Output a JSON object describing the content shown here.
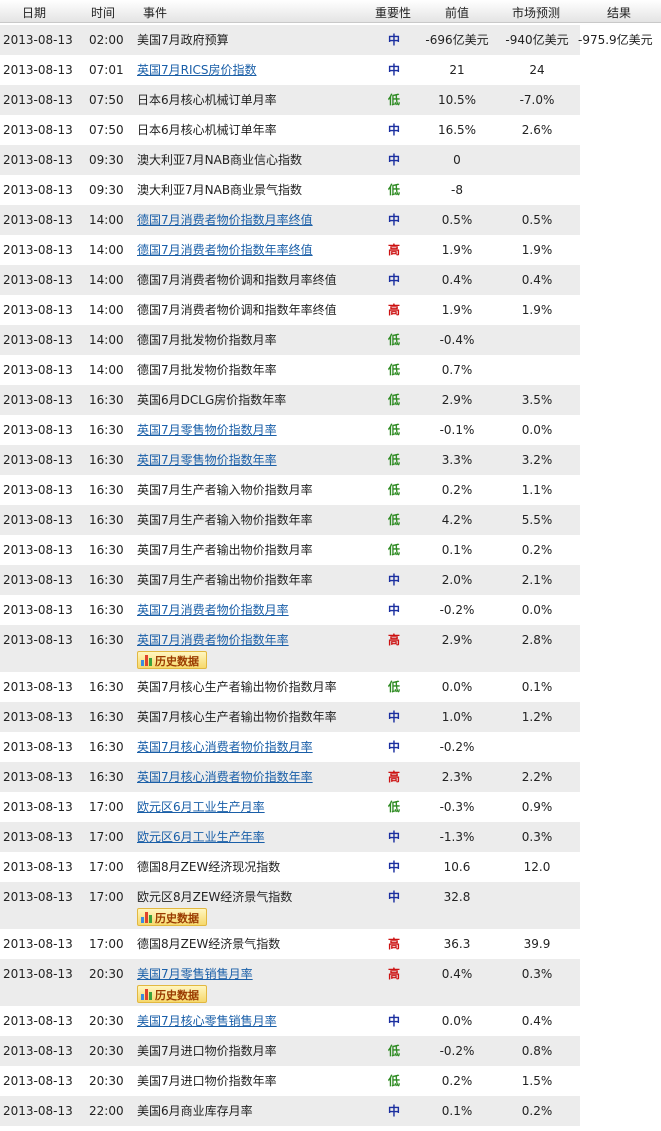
{
  "headers": {
    "date": "日期",
    "time": "时间",
    "event": "事件",
    "importance": "重要性",
    "previous": "前值",
    "forecast": "市场预测",
    "result": "结果"
  },
  "history_label": "历史数据",
  "colors": {
    "importance_medium": "#1b2fa0",
    "importance_low": "#2e8b22",
    "importance_high": "#cc1111",
    "link": "#1a5fa8",
    "stripe": "#ececec"
  },
  "rows": [
    {
      "date": "2013-08-13",
      "time": "02:00",
      "event": "美国7月政府预算",
      "link": false,
      "importance": "中",
      "previous": "-696亿美元",
      "forecast": "-940亿美元",
      "result": "-975.9亿美元"
    },
    {
      "date": "2013-08-13",
      "time": "07:01",
      "event": "英国7月RICS房价指数",
      "link": true,
      "importance": "中",
      "previous": "21",
      "forecast": "24",
      "result": ""
    },
    {
      "date": "2013-08-13",
      "time": "07:50",
      "event": "日本6月核心机械订单月率",
      "link": false,
      "importance": "低",
      "previous": "10.5%",
      "forecast": "-7.0%",
      "result": ""
    },
    {
      "date": "2013-08-13",
      "time": "07:50",
      "event": "日本6月核心机械订单年率",
      "link": false,
      "importance": "中",
      "previous": "16.5%",
      "forecast": "2.6%",
      "result": ""
    },
    {
      "date": "2013-08-13",
      "time": "09:30",
      "event": "澳大利亚7月NAB商业信心指数",
      "link": false,
      "importance": "中",
      "previous": "0",
      "forecast": "",
      "result": ""
    },
    {
      "date": "2013-08-13",
      "time": "09:30",
      "event": "澳大利亚7月NAB商业景气指数",
      "link": false,
      "importance": "低",
      "previous": "-8",
      "forecast": "",
      "result": ""
    },
    {
      "date": "2013-08-13",
      "time": "14:00",
      "event": "德国7月消费者物价指数月率终值",
      "link": true,
      "importance": "中",
      "previous": "0.5%",
      "forecast": "0.5%",
      "result": ""
    },
    {
      "date": "2013-08-13",
      "time": "14:00",
      "event": "德国7月消费者物价指数年率终值",
      "link": true,
      "importance": "高",
      "previous": "1.9%",
      "forecast": "1.9%",
      "result": ""
    },
    {
      "date": "2013-08-13",
      "time": "14:00",
      "event": "德国7月消费者物价调和指数月率终值",
      "link": false,
      "importance": "中",
      "previous": "0.4%",
      "forecast": "0.4%",
      "result": ""
    },
    {
      "date": "2013-08-13",
      "time": "14:00",
      "event": "德国7月消费者物价调和指数年率终值",
      "link": false,
      "importance": "高",
      "previous": "1.9%",
      "forecast": "1.9%",
      "result": ""
    },
    {
      "date": "2013-08-13",
      "time": "14:00",
      "event": "德国7月批发物价指数月率",
      "link": false,
      "importance": "低",
      "previous": "-0.4%",
      "forecast": "",
      "result": ""
    },
    {
      "date": "2013-08-13",
      "time": "14:00",
      "event": "德国7月批发物价指数年率",
      "link": false,
      "importance": "低",
      "previous": "0.7%",
      "forecast": "",
      "result": ""
    },
    {
      "date": "2013-08-13",
      "time": "16:30",
      "event": "英国6月DCLG房价指数年率",
      "link": false,
      "importance": "低",
      "previous": "2.9%",
      "forecast": "3.5%",
      "result": ""
    },
    {
      "date": "2013-08-13",
      "time": "16:30",
      "event": "英国7月零售物价指数月率",
      "link": true,
      "importance": "低",
      "previous": "-0.1%",
      "forecast": "0.0%",
      "result": ""
    },
    {
      "date": "2013-08-13",
      "time": "16:30",
      "event": "英国7月零售物价指数年率",
      "link": true,
      "importance": "低",
      "previous": "3.3%",
      "forecast": "3.2%",
      "result": ""
    },
    {
      "date": "2013-08-13",
      "time": "16:30",
      "event": "英国7月生产者输入物价指数月率",
      "link": false,
      "importance": "低",
      "previous": "0.2%",
      "forecast": "1.1%",
      "result": ""
    },
    {
      "date": "2013-08-13",
      "time": "16:30",
      "event": "英国7月生产者输入物价指数年率",
      "link": false,
      "importance": "低",
      "previous": "4.2%",
      "forecast": "5.5%",
      "result": ""
    },
    {
      "date": "2013-08-13",
      "time": "16:30",
      "event": "英国7月生产者输出物价指数月率",
      "link": false,
      "importance": "低",
      "previous": "0.1%",
      "forecast": "0.2%",
      "result": ""
    },
    {
      "date": "2013-08-13",
      "time": "16:30",
      "event": "英国7月生产者输出物价指数年率",
      "link": false,
      "importance": "中",
      "previous": "2.0%",
      "forecast": "2.1%",
      "result": ""
    },
    {
      "date": "2013-08-13",
      "time": "16:30",
      "event": "英国7月消费者物价指数月率",
      "link": true,
      "importance": "中",
      "previous": "-0.2%",
      "forecast": "0.0%",
      "result": ""
    },
    {
      "date": "2013-08-13",
      "time": "16:30",
      "event": "英国7月消费者物价指数年率",
      "link": true,
      "importance": "高",
      "previous": "2.9%",
      "forecast": "2.8%",
      "result": "",
      "history": true
    },
    {
      "date": "2013-08-13",
      "time": "16:30",
      "event": "英国7月核心生产者输出物价指数月率",
      "link": false,
      "importance": "低",
      "previous": "0.0%",
      "forecast": "0.1%",
      "result": ""
    },
    {
      "date": "2013-08-13",
      "time": "16:30",
      "event": "英国7月核心生产者输出物价指数年率",
      "link": false,
      "importance": "中",
      "previous": "1.0%",
      "forecast": "1.2%",
      "result": ""
    },
    {
      "date": "2013-08-13",
      "time": "16:30",
      "event": "英国7月核心消费者物价指数月率",
      "link": true,
      "importance": "中",
      "previous": "-0.2%",
      "forecast": "",
      "result": ""
    },
    {
      "date": "2013-08-13",
      "time": "16:30",
      "event": "英国7月核心消费者物价指数年率",
      "link": true,
      "importance": "高",
      "previous": "2.3%",
      "forecast": "2.2%",
      "result": ""
    },
    {
      "date": "2013-08-13",
      "time": "17:00",
      "event": "欧元区6月工业生产月率",
      "link": true,
      "importance": "低",
      "previous": "-0.3%",
      "forecast": "0.9%",
      "result": ""
    },
    {
      "date": "2013-08-13",
      "time": "17:00",
      "event": "欧元区6月工业生产年率",
      "link": true,
      "importance": "中",
      "previous": "-1.3%",
      "forecast": "0.3%",
      "result": ""
    },
    {
      "date": "2013-08-13",
      "time": "17:00",
      "event": "德国8月ZEW经济现况指数",
      "link": false,
      "importance": "中",
      "previous": "10.6",
      "forecast": "12.0",
      "result": ""
    },
    {
      "date": "2013-08-13",
      "time": "17:00",
      "event": "欧元区8月ZEW经济景气指数",
      "link": false,
      "importance": "中",
      "previous": "32.8",
      "forecast": "",
      "result": "",
      "history": true
    },
    {
      "date": "2013-08-13",
      "time": "17:00",
      "event": "德国8月ZEW经济景气指数",
      "link": false,
      "importance": "高",
      "previous": "36.3",
      "forecast": "39.9",
      "result": ""
    },
    {
      "date": "2013-08-13",
      "time": "20:30",
      "event": "美国7月零售销售月率",
      "link": true,
      "importance": "高",
      "previous": "0.4%",
      "forecast": "0.3%",
      "result": "",
      "history": true
    },
    {
      "date": "2013-08-13",
      "time": "20:30",
      "event": "美国7月核心零售销售月率",
      "link": true,
      "importance": "中",
      "previous": "0.0%",
      "forecast": "0.4%",
      "result": ""
    },
    {
      "date": "2013-08-13",
      "time": "20:30",
      "event": "美国7月进口物价指数月率",
      "link": false,
      "importance": "低",
      "previous": "-0.2%",
      "forecast": "0.8%",
      "result": ""
    },
    {
      "date": "2013-08-13",
      "time": "20:30",
      "event": "美国7月进口物价指数年率",
      "link": false,
      "importance": "低",
      "previous": "0.2%",
      "forecast": "1.5%",
      "result": ""
    },
    {
      "date": "2013-08-13",
      "time": "22:00",
      "event": "美国6月商业库存月率",
      "link": false,
      "importance": "中",
      "previous": "0.1%",
      "forecast": "0.2%",
      "result": ""
    }
  ]
}
